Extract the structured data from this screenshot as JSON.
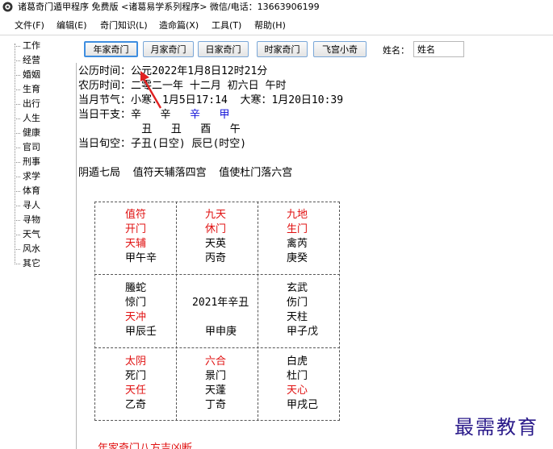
{
  "window": {
    "title": "诸葛奇门遁甲程序 免费版 <诸葛易学系列程序> 微信/电话：13663906199"
  },
  "menu": [
    "文件(F)",
    "编辑(E)",
    "奇门知识(L)",
    "造命篇(X)",
    "工具(T)",
    "帮助(H)"
  ],
  "sidebar": [
    "工作",
    "经营",
    "婚姻",
    "生育",
    "出行",
    "人生",
    "健康",
    "官司",
    "刑事",
    "求学",
    "体育",
    "寻人",
    "寻物",
    "天气",
    "风水",
    "其它"
  ],
  "toolbar": {
    "buttons": [
      "年家奇门",
      "月家奇门",
      "日家奇门",
      "时家奇门",
      "飞宫小奇"
    ],
    "active": "年家奇门",
    "name_label": "姓名：",
    "name_value": "姓名"
  },
  "info": {
    "solar": "公历时间：公元2022年1月8日12时21分",
    "lunar": "农历时间：二零二一年 十二月 初六日 午时",
    "solar_terms": "当月节气：小寒：1月5日17:14  大寒：1月20日10:39",
    "ganzhi_label": "当日干支：",
    "stems": [
      "辛",
      "辛",
      "辛",
      "甲"
    ],
    "branches": [
      "丑",
      "丑",
      "酉",
      "午"
    ],
    "xunkong": "当日旬空：子丑(日空) 辰巳(时空)",
    "ju": "阴遁七局  值符天辅落四宫  值使杜门落六宫"
  },
  "palaces": [
    [
      [
        {
          "text": "值符",
          "color": "red"
        },
        {
          "text": "开门",
          "color": "red"
        },
        {
          "text": "天辅",
          "color": "red"
        },
        {
          "text": "甲午辛",
          "color": "black"
        }
      ],
      [
        {
          "text": "九天",
          "color": "red"
        },
        {
          "text": "休门",
          "color": "red"
        },
        {
          "text": "天英",
          "color": "black"
        },
        {
          "text": "丙奇",
          "color": "black"
        }
      ],
      [
        {
          "text": "九地",
          "color": "red"
        },
        {
          "text": "生门",
          "color": "red"
        },
        {
          "text": "禽芮",
          "color": "black"
        },
        {
          "text": "庚癸",
          "color": "black"
        }
      ]
    ],
    [
      [
        {
          "text": "螣蛇",
          "color": "black"
        },
        {
          "text": "惊门",
          "color": "black"
        },
        {
          "text": "天冲",
          "color": "red"
        },
        {
          "text": "甲辰壬",
          "color": "black"
        }
      ],
      [
        {
          "text": "",
          "color": "black"
        },
        {
          "text": "2021年辛丑",
          "color": "black"
        },
        {
          "text": "",
          "color": "black"
        },
        {
          "text": "甲申庚",
          "color": "black"
        }
      ],
      [
        {
          "text": "玄武",
          "color": "black"
        },
        {
          "text": "伤门",
          "color": "black"
        },
        {
          "text": "天柱",
          "color": "black"
        },
        {
          "text": "甲子戊",
          "color": "black"
        }
      ]
    ],
    [
      [
        {
          "text": "太阴",
          "color": "red"
        },
        {
          "text": "死门",
          "color": "black"
        },
        {
          "text": "天任",
          "color": "red"
        },
        {
          "text": "乙奇",
          "color": "black"
        }
      ],
      [
        {
          "text": "六合",
          "color": "red"
        },
        {
          "text": "景门",
          "color": "black"
        },
        {
          "text": "天蓬",
          "color": "black"
        },
        {
          "text": "丁奇",
          "color": "black"
        }
      ],
      [
        {
          "text": "白虎",
          "color": "black"
        },
        {
          "text": "杜门",
          "color": "black"
        },
        {
          "text": "天心",
          "color": "red"
        },
        {
          "text": "甲戌己",
          "color": "black"
        }
      ]
    ]
  ],
  "footer_partial": "年家奇门八方吉凶断",
  "watermark": "最需教育",
  "colors": {
    "red": "#e01010",
    "blue": "#1010d8",
    "arrow": "#e02020"
  }
}
